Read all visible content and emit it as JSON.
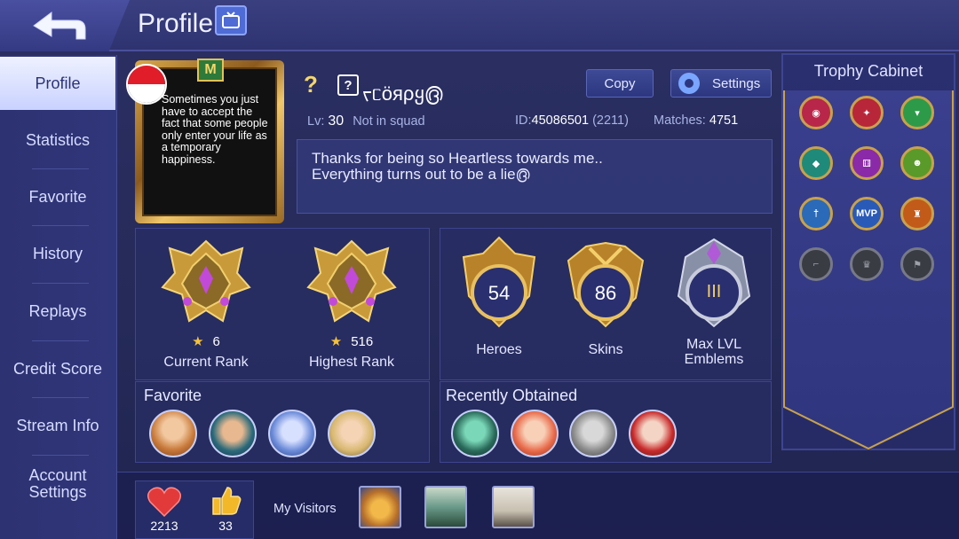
{
  "header": {
    "title": "Profile",
    "back_icon": "back-arrow-icon",
    "tv_icon": "tv-icon"
  },
  "sidebar": {
    "items": [
      {
        "label": "Profile",
        "active": true
      },
      {
        "label": "Statistics"
      },
      {
        "label": "Favorite"
      },
      {
        "label": "History"
      },
      {
        "label": "Replays"
      },
      {
        "label": "Credit Score"
      },
      {
        "label": "Stream Info"
      },
      {
        "label": "Account\nSettings"
      }
    ]
  },
  "profile": {
    "frame_quote": "Sometimes you just have to accept the fact that some people only enter your life as a temporary happiness.",
    "emblem_letter": "M",
    "question_mark": "?",
    "name_box_glyph": "?",
    "name": "ᡕᥴöяρყ൫",
    "level_label": "Lv:",
    "level": "30",
    "squad_status": "Not in squad",
    "id_label": "ID:",
    "id": "45086501",
    "server": "(2211)",
    "matches_label": "Matches:",
    "matches": "4751",
    "copy_label": "Copy",
    "settings_label": "Settings",
    "bio_line1": "Thanks for being so Heartless towards me..",
    "bio_line2": "Everything turns out to be a lie൫"
  },
  "ranks": {
    "current": {
      "stars": "6",
      "label": "Current Rank"
    },
    "highest": {
      "stars": "516",
      "label": "Highest Rank"
    }
  },
  "stats": {
    "heroes": {
      "value": "54",
      "label": "Heroes"
    },
    "skins": {
      "value": "86",
      "label": "Skins"
    },
    "emblems": {
      "value": "III",
      "label_line1": "Max LVL",
      "label_line2": "Emblems"
    }
  },
  "favorite": {
    "title": "Favorite"
  },
  "recent": {
    "title": "Recently Obtained"
  },
  "trophy_cabinet": {
    "title": "Trophy Cabinet",
    "trophies": [
      {
        "icon": "eye-trophy-icon",
        "color": "#b8264a"
      },
      {
        "icon": "claw-trophy-icon",
        "color": "#b8263a"
      },
      {
        "icon": "shirt-trophy-icon",
        "color": "#2d9a4a"
      },
      {
        "icon": "gem-trophy-icon",
        "color": "#1f8a7a"
      },
      {
        "icon": "dice-trophy-icon",
        "color": "#8a2aa8"
      },
      {
        "icon": "friends-trophy-icon",
        "color": "#5a9a2a"
      },
      {
        "icon": "sword-trophy-icon",
        "color": "#2a6ab8"
      },
      {
        "icon": "mvp-trophy-icon",
        "color": "#2a5ab8",
        "text": "MVP"
      },
      {
        "icon": "tower-trophy-icon",
        "color": "#c25a1a"
      },
      {
        "icon": "boot-trophy-icon",
        "locked": true
      },
      {
        "icon": "cup-trophy-icon",
        "locked": true
      },
      {
        "icon": "flag-trophy-icon",
        "locked": true
      }
    ]
  },
  "footer": {
    "hearts": "2213",
    "thumbs": "33",
    "visitors_label": "My Visitors"
  },
  "colors": {
    "accent_gold": "#e2c25a",
    "panel_blue": "#2d3272",
    "heart_red": "#e23a3a",
    "thumb_yellow": "#f2b82a"
  }
}
